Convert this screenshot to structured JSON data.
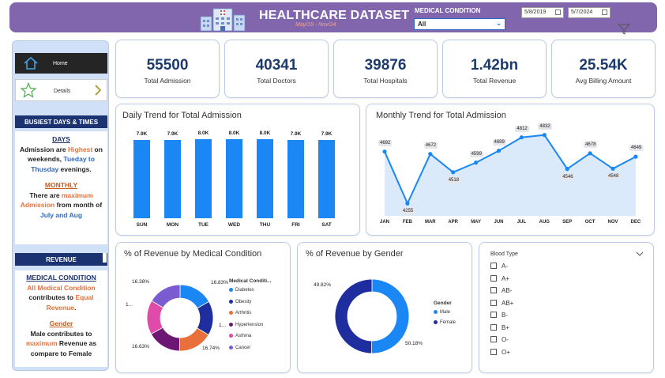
{
  "header": {
    "title": "HEALTHCARE DATASET",
    "range": "May/19 - Nov/24",
    "medical_condition_label": "MEDICAL CONDITION",
    "medical_condition_value": "All",
    "start_date": "5/8/2019",
    "end_date": "5/7/2024",
    "colors": {
      "header_bg": "#8166ad",
      "accent": "#1a87f5",
      "navy": "#1c3371"
    }
  },
  "sidebar": {
    "nav_home": "Home",
    "nav_details": "Details",
    "busiest_title": "BUSIEST DAYS & TIMES",
    "days_head": "DAYS",
    "days_text_1": "Admission are",
    "days_text_2": "Highest",
    "days_text_3": "on weekends,",
    "days_text_4": "Tueday to Thusday",
    "days_text_5": "evenings.",
    "monthly_head": "MONTHLY",
    "monthly_text_1": "There are",
    "monthly_text_2": "maximum Admission",
    "monthly_text_3": "from month of",
    "monthly_text_4": "July and Aug",
    "revenue_title": "REVENUE",
    "mc_head": "MEDICAL CONDITION",
    "mc_text_1": "All Medical Condition",
    "mc_text_2": "contributes to",
    "mc_text_3": "Equal Revenue",
    "gender_head": "Gender",
    "gender_text_1": "Male contributes to",
    "gender_text_2": "maximum",
    "gender_text_3": "Revenue as compare to Female"
  },
  "kpis": [
    {
      "value": "55500",
      "label": "Total Admission"
    },
    {
      "value": "40341",
      "label": "Total Doctors"
    },
    {
      "value": "39876",
      "label": "Total Hospitals"
    },
    {
      "value": "1.42bn",
      "label": "Total Revenue"
    },
    {
      "value": "25.54K",
      "label": "Avg Billing Amount"
    }
  ],
  "daily": {
    "title": "Daily Trend for Total Admission"
  },
  "monthly": {
    "title": "Monthly Trend for Total Admission"
  },
  "revenue_condition": {
    "title": "% of Revenue by Medical Condition",
    "legend_title": "Medical Conditi...",
    "labels": [
      "16.83%",
      "1...",
      "16.74%",
      "16.63%",
      "1...",
      "16.38%"
    ]
  },
  "revenue_gender": {
    "title": "% of Revenue by Gender",
    "legend_title": "Gender",
    "labels": [
      "49.82%",
      "50.18%"
    ]
  },
  "blood_type": {
    "title": "Blood Type",
    "items": [
      "A-",
      "A+",
      "AB-",
      "AB+",
      "B-",
      "B+",
      "O-",
      "O+"
    ]
  },
  "chart_data": [
    {
      "type": "bar",
      "title": "Daily Trend for Total Admission",
      "categories": [
        "SUN",
        "MON",
        "TUE",
        "WED",
        "THU",
        "FRI",
        "SAT"
      ],
      "values": [
        7.9,
        7.9,
        8.0,
        8.0,
        8.0,
        7.9,
        7.9
      ],
      "data_labels": [
        "7.9K",
        "7.9K",
        "8.0K",
        "8.0K",
        "8.0K",
        "7.9K",
        "7.9K"
      ],
      "ylim": [
        0,
        8.6
      ],
      "grid": false,
      "color": "#1a87f5"
    },
    {
      "type": "area",
      "title": "Monthly Trend for Total Admission",
      "categories": [
        "JAN",
        "FEB",
        "MAR",
        "APR",
        "MAY",
        "JUN",
        "JUL",
        "AUG",
        "SEP",
        "OCT",
        "NOV",
        "DEC"
      ],
      "values": [
        4692,
        4255,
        4672,
        4518,
        4599,
        4699,
        4812,
        4832,
        4546,
        4678,
        4548,
        4649
      ],
      "ylim": [
        4150,
        4850
      ],
      "grid": false,
      "color": "#1a87f5"
    },
    {
      "type": "pie",
      "title": "% of Revenue by Medical Condition",
      "legend": "right",
      "slices": [
        {
          "name": "Diabetes",
          "value": 16.83,
          "color": "#1a87f5"
        },
        {
          "name": "Obesity",
          "value": 16.71,
          "color": "#1f2e9e"
        },
        {
          "name": "Arthritis",
          "value": 16.74,
          "color": "#e9703a"
        },
        {
          "name": "Hypertension",
          "value": 16.63,
          "color": "#6b1773"
        },
        {
          "name": "Asthma",
          "value": 16.71,
          "color": "#e04aa8"
        },
        {
          "name": "Cancer",
          "value": 16.38,
          "color": "#7b5bd0"
        }
      ]
    },
    {
      "type": "pie",
      "title": "% of Revenue by Gender",
      "legend": "right",
      "slices": [
        {
          "name": "Male",
          "value": 50.18,
          "color": "#1a87f5"
        },
        {
          "name": "Female",
          "value": 49.82,
          "color": "#1f2e9e"
        }
      ]
    }
  ]
}
